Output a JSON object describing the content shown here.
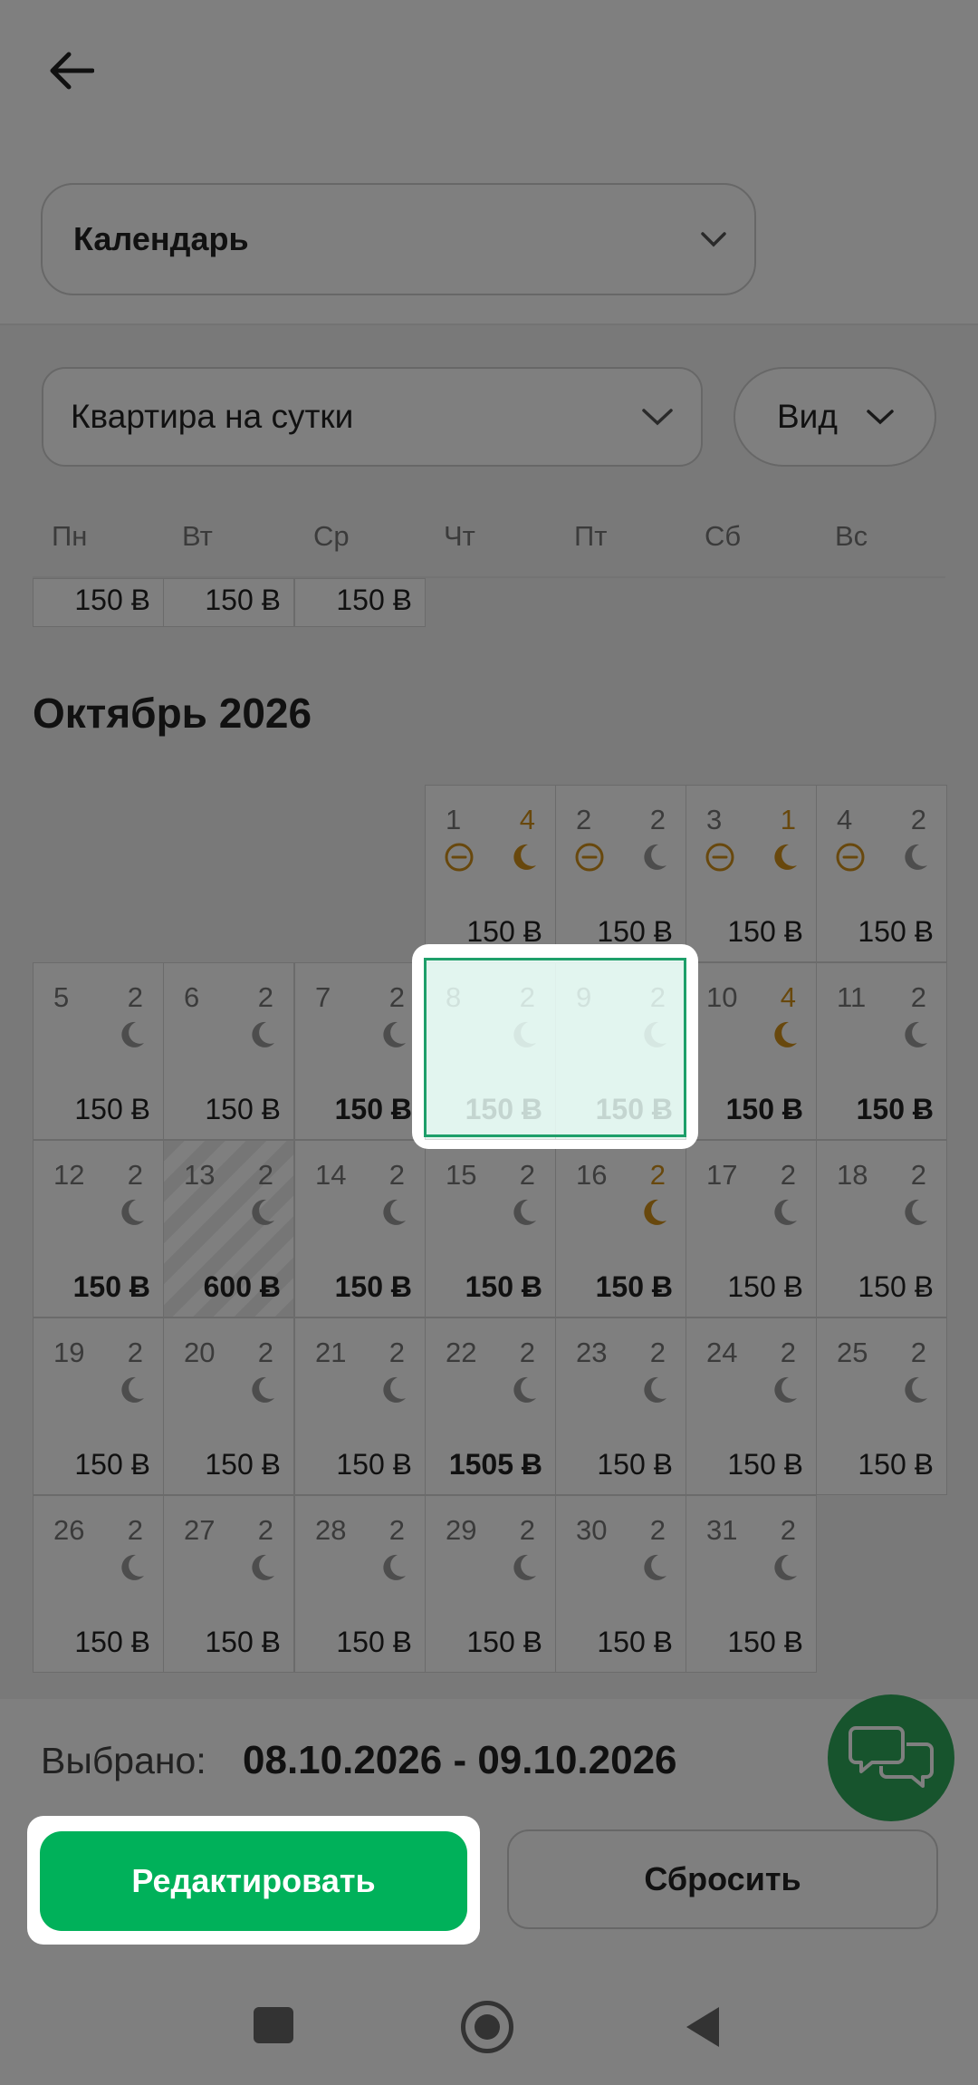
{
  "header": {
    "calendar_select": "Календарь"
  },
  "filters": {
    "property_select": "Квартира на сутки",
    "view_button": "Вид"
  },
  "weekdays": [
    "Пн",
    "Вт",
    "Ср",
    "Чт",
    "Пт",
    "Сб",
    "Вс"
  ],
  "prev_row_prices": [
    "150 Ƀ",
    "150 Ƀ",
    "150 Ƀ"
  ],
  "month": {
    "title": "Октябрь 2026",
    "days": {
      "d1": {
        "num": "1",
        "cnt": "4",
        "price": "150 Ƀ"
      },
      "d2": {
        "num": "2",
        "cnt": "2",
        "price": "150 Ƀ"
      },
      "d3": {
        "num": "3",
        "cnt": "1",
        "price": "150 Ƀ"
      },
      "d4": {
        "num": "4",
        "cnt": "2",
        "price": "150 Ƀ"
      },
      "d5": {
        "num": "5",
        "cnt": "2",
        "price": "150 Ƀ"
      },
      "d6": {
        "num": "6",
        "cnt": "2",
        "price": "150 Ƀ"
      },
      "d7": {
        "num": "7",
        "cnt": "2",
        "price": "150 Ƀ"
      },
      "d8": {
        "num": "8",
        "cnt": "2",
        "price": "150 Ƀ"
      },
      "d9": {
        "num": "9",
        "cnt": "2",
        "price": "150 Ƀ"
      },
      "d10": {
        "num": "10",
        "cnt": "4",
        "price": "150 Ƀ"
      },
      "d11": {
        "num": "11",
        "cnt": "2",
        "price": "150 Ƀ"
      },
      "d12": {
        "num": "12",
        "cnt": "2",
        "price": "150 Ƀ"
      },
      "d13": {
        "num": "13",
        "cnt": "2",
        "price": "600 Ƀ"
      },
      "d14": {
        "num": "14",
        "cnt": "2",
        "price": "150 Ƀ"
      },
      "d15": {
        "num": "15",
        "cnt": "2",
        "price": "150 Ƀ"
      },
      "d16": {
        "num": "16",
        "cnt": "2",
        "price": "150 Ƀ"
      },
      "d17": {
        "num": "17",
        "cnt": "2",
        "price": "150 Ƀ"
      },
      "d18": {
        "num": "18",
        "cnt": "2",
        "price": "150 Ƀ"
      },
      "d19": {
        "num": "19",
        "cnt": "2",
        "price": "150 Ƀ"
      },
      "d20": {
        "num": "20",
        "cnt": "2",
        "price": "150 Ƀ"
      },
      "d21": {
        "num": "21",
        "cnt": "2",
        "price": "150 Ƀ"
      },
      "d22": {
        "num": "22",
        "cnt": "2",
        "price": "1505 Ƀ"
      },
      "d23": {
        "num": "23",
        "cnt": "2",
        "price": "150 Ƀ"
      },
      "d24": {
        "num": "24",
        "cnt": "2",
        "price": "150 Ƀ"
      },
      "d25": {
        "num": "25",
        "cnt": "2",
        "price": "150 Ƀ"
      },
      "d26": {
        "num": "26",
        "cnt": "2",
        "price": "150 Ƀ"
      },
      "d27": {
        "num": "27",
        "cnt": "2",
        "price": "150 Ƀ"
      },
      "d28": {
        "num": "28",
        "cnt": "2",
        "price": "150 Ƀ"
      },
      "d29": {
        "num": "29",
        "cnt": "2",
        "price": "150 Ƀ"
      },
      "d30": {
        "num": "30",
        "cnt": "2",
        "price": "150 Ƀ"
      },
      "d31": {
        "num": "31",
        "cnt": "2",
        "price": "150 Ƀ"
      }
    }
  },
  "footer": {
    "selected_label": "Выбрано:",
    "selected_value": "08.10.2026 - 09.10.2026",
    "edit_button": "Редактировать",
    "reset_button": "Сбросить"
  },
  "icons": {
    "back": "arrow-left-icon",
    "chevron": "chevron-down-icon",
    "moon": "moon-icon",
    "blocked": "minus-circle-icon",
    "chat": "chat-icon"
  },
  "colors": {
    "primary": "#00b15a",
    "orange": "#d0901a",
    "selection": "#1e9f6a"
  }
}
